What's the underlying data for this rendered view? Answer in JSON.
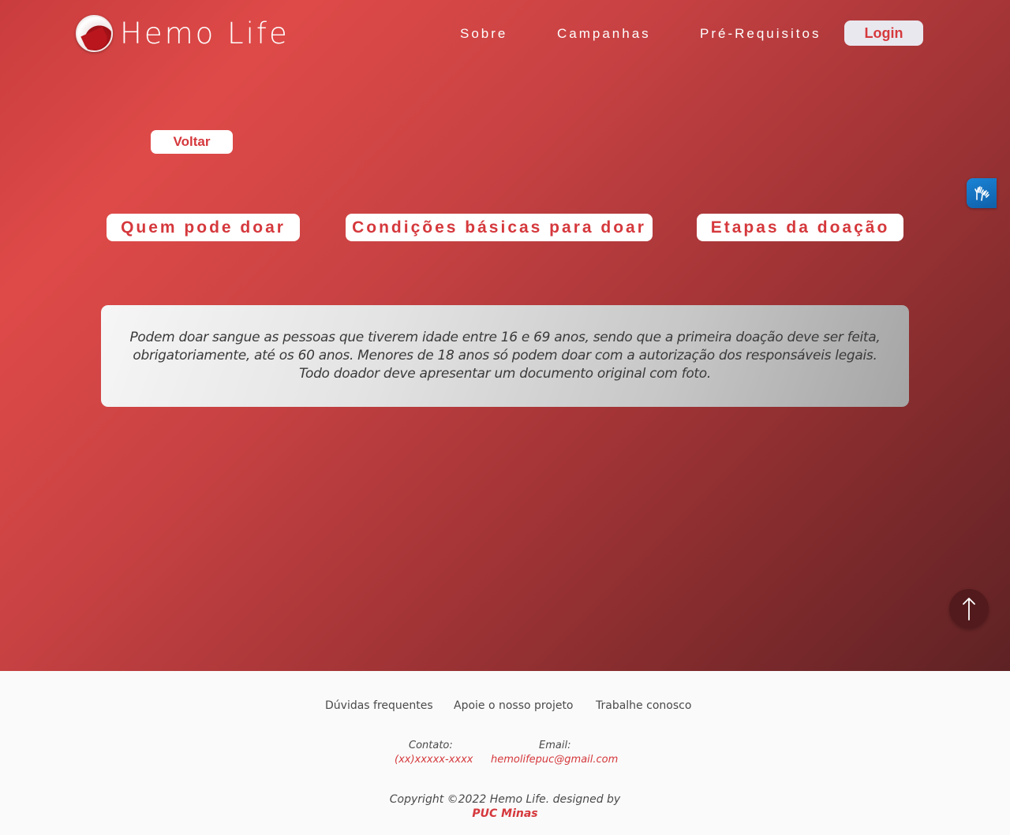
{
  "header": {
    "brand": "Hemo Life",
    "nav": {
      "sobre": "Sobre",
      "campanhas": "Campanhas",
      "prerequisitos": "Pré-Requisitos"
    },
    "login_label": "Login"
  },
  "main": {
    "back_label": "Voltar",
    "tabs": [
      {
        "label": "Quem pode doar"
      },
      {
        "label": "Condições básicas para doar"
      },
      {
        "label": "Etapas da doação"
      }
    ],
    "info_text": "Podem doar sangue as pessoas que tiverem idade entre 16 e 69 anos, sendo que a primeira doação deve ser feita, obrigatoriamente, até os 60 anos. Menores de 18 anos só podem doar com a autorização dos responsáveis legais. Todo doador deve apresentar um documento original com foto."
  },
  "footer": {
    "links": {
      "duvidas": "Dúvidas frequentes",
      "apoie": "Apoie o nosso projeto",
      "trabalhe": "Trabalhe conosco"
    },
    "contact_label": "Contato:",
    "contact_value": "(xx)xxxxx-xxxx",
    "email_label": "Email:",
    "email_value": "hemolifepuc@gmail.com",
    "copyright": "Copyright ©2022 Hemo Life. designed by",
    "credit": "PUC Minas"
  },
  "icons": {
    "accessibility": "sign-language-hands-icon",
    "back_to_top": "arrow-up-icon"
  },
  "colors": {
    "brand_red": "#d5383c",
    "footer_bg": "#fafafa",
    "accessibility_blue": "#1a84d6"
  }
}
